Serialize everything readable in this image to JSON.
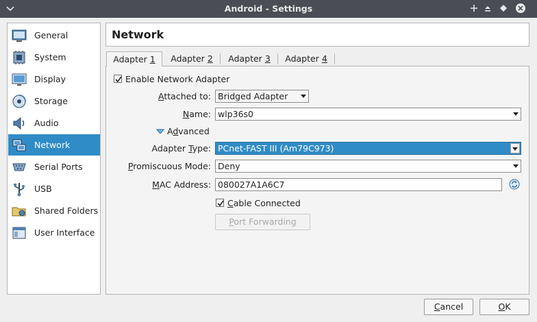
{
  "window": {
    "title": "Android - Settings"
  },
  "sidebar": {
    "items": [
      {
        "label": "General",
        "icon": "general-icon"
      },
      {
        "label": "System",
        "icon": "system-chip-icon"
      },
      {
        "label": "Display",
        "icon": "display-icon"
      },
      {
        "label": "Storage",
        "icon": "storage-icon"
      },
      {
        "label": "Audio",
        "icon": "audio-icon"
      },
      {
        "label": "Network",
        "icon": "network-icon",
        "active": true
      },
      {
        "label": "Serial Ports",
        "icon": "serial-ports-icon"
      },
      {
        "label": "USB",
        "icon": "usb-icon"
      },
      {
        "label": "Shared Folders",
        "icon": "shared-folders-icon"
      },
      {
        "label": "User Interface",
        "icon": "user-interface-icon"
      }
    ]
  },
  "header": {
    "title": "Network"
  },
  "tabs": [
    {
      "prefix": "Adapter ",
      "mnemonic": "1",
      "active": true
    },
    {
      "prefix": "Adapter ",
      "mnemonic": "2"
    },
    {
      "prefix": "Adapter ",
      "mnemonic": "3"
    },
    {
      "prefix": "Adapter ",
      "mnemonic": "4"
    }
  ],
  "adapter": {
    "enable_label": "Enable Network Adapter",
    "enable_checked": true,
    "attached_to": {
      "label_m": "A",
      "label_rest": "ttached to:",
      "value": "Bridged Adapter"
    },
    "name": {
      "label_m": "N",
      "label_rest": "ame:",
      "value": "wlp36s0"
    },
    "advanced": {
      "label_pre": "A",
      "label_m": "d",
      "label_rest": "vanced"
    },
    "adapter_type": {
      "label_pre": "Adapter ",
      "label_m": "T",
      "label_rest": "ype:",
      "value": "PCnet-FAST III (Am79C973)"
    },
    "promiscuous": {
      "label_m": "P",
      "label_rest": "romiscuous Mode:",
      "value": "Deny"
    },
    "mac": {
      "label_m": "M",
      "label_rest": "AC Address:",
      "value": "080027A1A6C7"
    },
    "cable": {
      "label_m": "C",
      "label_rest": "able Connected",
      "checked": true
    },
    "port_forwarding": {
      "label_m": "P",
      "label_rest": "ort Forwarding"
    }
  },
  "buttons": {
    "cancel": {
      "label_m": "C",
      "label_rest": "ancel"
    },
    "ok": {
      "label_m": "O",
      "label_rest": "K"
    }
  },
  "colors": {
    "accent": "#308cc6",
    "titlebar": "#4a4e54"
  }
}
